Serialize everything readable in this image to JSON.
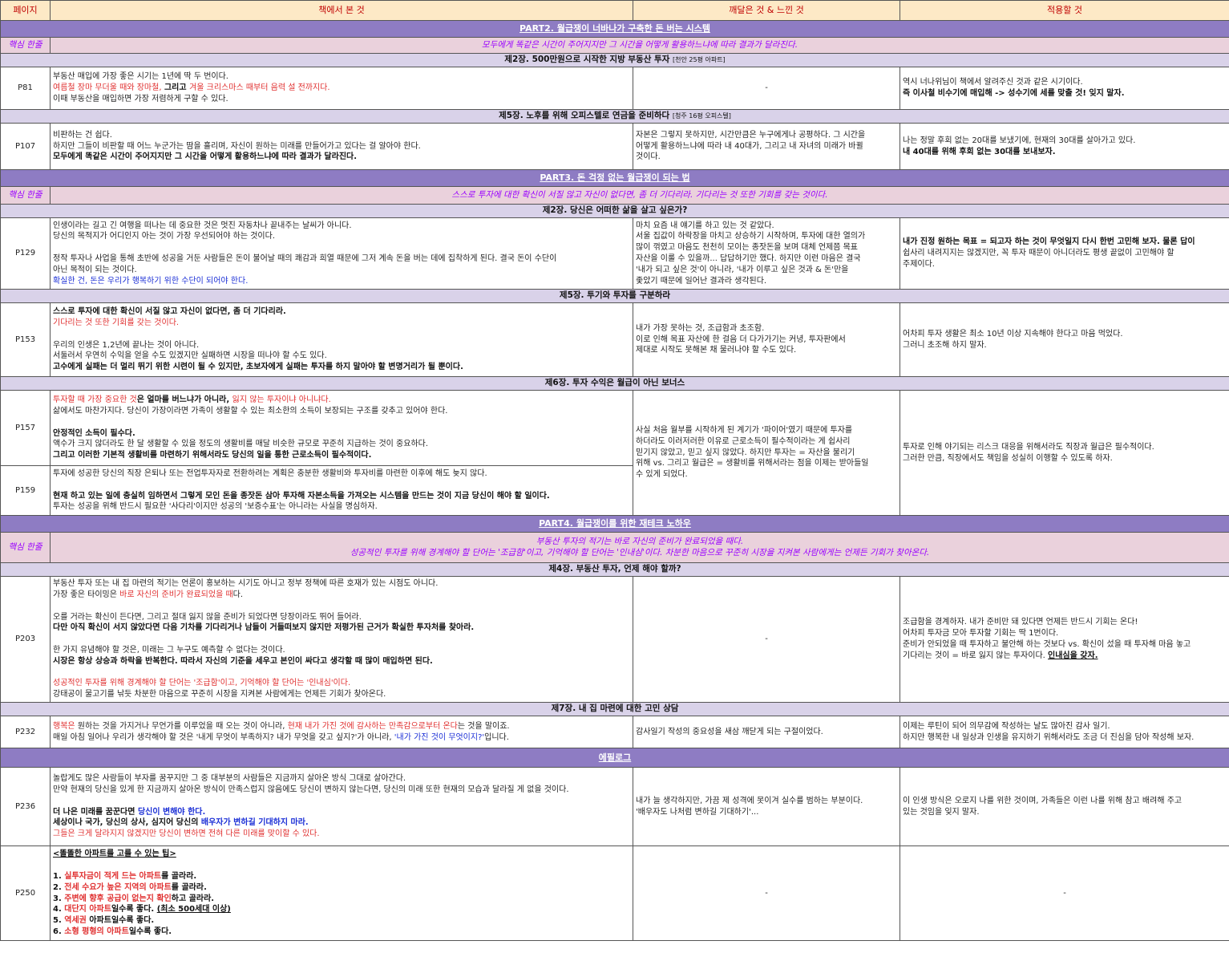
{
  "headers": {
    "page": "페이지",
    "book": "책에서 본 것",
    "realize": "깨달은 것 & 느낀 것",
    "apply": "적용할 것"
  },
  "core_label": "핵심 한줄",
  "part2": {
    "title": "PART2. 월급쟁이 너바나가 구축한 돈 버는 시스템",
    "core": "모두에게 똑같은 시간이 주어지지만 그 시간을 어떻게 활용하느냐에 따라 결과가 달라진다.",
    "ch2": {
      "title": "제2장. 500만원으로 시작한 지방 부동산 투자",
      "sub": "[천안 25평 아파트]"
    },
    "p81": {
      "page": "P81",
      "book": [
        "부동산 매입에 가장 좋은 시기는 1년에 딱 두 번이다.",
        "여름철 장마 무더울 때와 장마철,",
        " 그리고 ",
        "겨울 크리스마스 때부터 음력 설 전까지다.",
        "이때 부동산을 매입하면 가장 저렴하게 구할 수 있다."
      ],
      "realize": "-",
      "apply": [
        "역시 너나위님이 책에서 알려주신 것과 같은 시기이다.",
        "즉 이사철 비수기에 매입해 -> 성수기에 세를 맞출 것! 잊지 말자."
      ]
    },
    "ch5": {
      "title": "제5장. 노후를 위해 오피스텔로 연금을 준비하다",
      "sub": "[청주 16평 오피스텔]"
    },
    "p107": {
      "page": "P107",
      "book": [
        "비판하는 건 쉽다.",
        "하지만 그들이 비판할 때 어느 누군가는 땀을 흘리며, 자신이 원하는 미래를 만들어가고 있다는 걸 알아야 한다.",
        "모두에게 똑같은 시간이 주어지지만 그 시간을 어떻게 활용하느냐에 따라 결과가 달라진다."
      ],
      "realize": [
        "자본은 그렇지 못하지만, 시간만큼은 누구에게나 공평하다. 그 시간을",
        "어떻게 활용하느냐에 따라 내 40대가, 그리고 내 자녀의 미래가 바뀔",
        "것이다."
      ],
      "apply": [
        "나는 정말 후회 없는 20대를 보냈기에, 현재의 30대를 살아가고 있다.",
        "내 40대를 위해 후회 없는 30대를 보내보자."
      ]
    }
  },
  "part3": {
    "title": "PART3. 돈 걱정 없는 월급쟁이 되는 법",
    "core": "스스로 투자에 대한 확신이 서질 않고 자신이 없다면, 좀 더 기다리라. 기다리는 것 또한 기회를 갖는 것이다.",
    "ch2": {
      "title": "제2장. 당신은 어떠한 삶을 살고 싶은가?"
    },
    "p129": {
      "page": "P129",
      "book": [
        "인생이라는 길고 긴 여행을 떠나는 데 중요한 것은 멋진 자동차나 끝내주는 날씨가 아니다.",
        "당신의 목적지가 어디인지 아는 것이 가장 우선되어야 하는 것이다.",
        "정작 투자나 사업을 통해 초반에 성공을 거둔 사람들은 돈이 불어날 때의 쾌감과 희열 때문에 그저 계속 돈을 버는 데에 집착하게 된다. 결국 돈이 수단이",
        "아닌 목적이 되는 것이다.",
        "확실한 건, 돈은 우리가 행복하기 위한 수단이 되어야 한다."
      ],
      "realize": [
        "마치 요즘 내 얘기를 하고 있는 것 같았다.",
        "서울 집값이 하락장을 마치고 상승하기 시작하며, 투자에 대한 열의가",
        "많이 꺾였고 마음도 천천히 모이는 종잣돈을 보며 대체 언제쯤 목표",
        "자산을 이룰 수 있을까... 답답하기만 했다. 하지만 이런 마음은 결국",
        "'내가 되고 싶은 것'이 아니라, '내가 이루고 싶은 것과 & 돈'만을",
        "좇았기 때문에 일어난 결과라 생각된다."
      ],
      "apply": [
        "내가 진정 원하는 목표 = 되고자 하는 것이 무엇일지 다시 한번 고민해 보자. 물론 답이",
        "쉽사리 내려지지는 않겠지만, 꼭 투자 때문이 아니더라도 평생 끝없이 고민해야 할",
        "주제이다."
      ]
    },
    "ch5": {
      "title": "제5장. 투기와 투자를 구분하라"
    },
    "p153": {
      "page": "P153",
      "book": [
        "스스로 투자에 대한 확신이 서질 않고 자신이 없다면, 좀 더 기다리라.",
        "기다리는 것 또한 기회를 갖는 것이다.",
        "우리의 인생은 1,2년에 끝나는 것이 아니다.",
        "서둘러서 우연히 수익을 얻을 수도 있겠지만 실패하면 시장을 떠나야 할 수도 있다.",
        "고수에게 실패는 더 멀리 뛰기 위한 시련이 될 수 있지만, 초보자에게 실패는 투자를 하지 말아야 할 변명거리가 될 뿐이다."
      ],
      "realize": [
        "내가 가장 못하는 것, 조급함과 초조함.",
        "이로 인해 목표 자산에 한 걸음 더 다가가기는 커녕, 투자판에서",
        "제대로 시작도 못해본 채 물러나야 할 수도 있다."
      ],
      "apply": [
        "어차피 투자 생활은 최소 10년 이상 지속해야 한다고 마음 먹었다.",
        "그러니 초조해 하지 말자."
      ]
    },
    "ch6": {
      "title": "제6장. 투자 수익은 월급이 아닌 보너스"
    },
    "p157": {
      "page": "P157",
      "book": [
        "투자할 때 가장 중요한 것",
        "은 얼마를 버느냐가 아니라, ",
        "잃지 않는 투자이냐 아니냐다.",
        "삶에서도 마찬가지다. 당신이 가장이라면 가족이 생활할 수 있는 최소한의 소득이 보장되는 구조를 갖추고 있어야 한다.",
        "안정적인 소득이 필수다.",
        "액수가 크지 않더라도 한 달 생활할 수 있을 정도의 생활비를 매달 비슷한 규모로 꾸준히 지급하는 것이 중요하다.",
        "그리고 ",
        "이러한 기본적 생활비를 마련하기 위해서라도 당신의 일을 통한 근로소득이 필수적",
        "이다."
      ],
      "realize": [
        "사실 처음 월부를 시작하게 된 계기가 '파이어'였기 때문에 투자를",
        "하더라도 이러저러한 이유로 근로소득이 필수적이라는 게 쉽사리",
        "믿기지 않았고, 믿고 싶지 않았다. 하지만 투자는 = 자산을 불리기",
        "위해 vs. 그리고 월급은 = 생활비를 위해서라는 점을 이제는 받아들일",
        "수 있게 되었다."
      ],
      "apply": [
        "투자로 인해 야기되는 리스크 대응을 위해서라도 직장과 월급은 필수적이다.",
        "그러한 만큼, 직장에서도 책임을 성실히 이행할 수 있도록 하자."
      ]
    },
    "p159": {
      "page": "P159",
      "book": [
        "투자에 성공한 당신의 직장 은퇴나 또는 전업투자자로 전환하려는 계획은  충분한 생활비와 투자비를 마련한 이후에 해도 늦지 않다.",
        "현재 하고 있는 일에 충실히 임하면서 그렇게 모인 돈을 종잣돈 삼아 투자해 자본소득을 가져오는 시스템을 만드는 것",
        "이 지금 당신이 해야 할 일이다.",
        "투자는 성공을 위해 반드시 필요한 '사다리'이지만 성공의 '보증수표'는 아니라는 사실을 명심하자."
      ]
    }
  },
  "part4": {
    "title": "PART4. 월급쟁이를 위한 재테크 노하우",
    "core": [
      "부동산 투자의 적기는 바로 자신의 준비가 완료되었을 때다.",
      "성공적인 투자를 위해 경계해야 할 단어는 '조급함'이고, 기억해야 할 단어는 '인내심'이다. 차분한 마음으로 꾸준히 시장을 지켜본 사람에게는 언제든 기회가 찾아온다."
    ],
    "ch4": {
      "title": "제4장. 부동산 투자, 언제 해야 할까?"
    },
    "p203": {
      "page": "P203",
      "book": [
        "부동산 투자 또는 내 집 마련의 적기는 언론이 홍보하는 시기도 아니고 정부 정책에 따른 호재가 있는 시점도 아니다.",
        "가장 좋은 타이밍은 ",
        "바로 자신의 준비가 완료되었을 때",
        "다.",
        "오를 거라는 확신이 든다면, 그리고 절대 잃지 않을 준비가 되었다면 당장이라도 뛰어 들어라.",
        "다만 아직 확신이 서지 않았다면 다음 기차를 기다리거나 남들이 거들떠보지 않지만 저평가된 근거가 확실한 투자처를 찾아라.",
        "한 가지 유념해야 할 것은, 미래는 그 누구도 예측할 수 없다는 것이다.",
        "시장은 항상 상승과 하락을 반복한다. 따라서 자신의 기준을 세우고 본인이 싸다고 생각할 때 많이 매입하면 된다.",
        "성공적인 투자를 위해 경계해야 할 단어는 '조급함'이고, 기억해야 할 단어는 '인내심'이다.",
        "강태공이 물고기를 낚듯 차분한 마음으로 꾸준히 시장을 지켜본 사람에게는 언제든 기회가 찾아온다."
      ],
      "realize": "-",
      "apply": [
        "조급함을 경계하자. 내가 준비만 돼 있다면 언제든 반드시 기회는 온다!",
        "어차피 투자금 모아 투자할 기회는 딱 1번이다.",
        "준비가 안되었을 때 투자하고 불안해 하는 것보다 vs. 확신이 섰을 때 투자해 마음 놓고",
        "기다리는 것이 = 바로 잃지 않는 투자이다. ",
        "인내심을 갖자."
      ]
    },
    "ch7": {
      "title": "제7장. 내 집 마련에 대한 고민 상담"
    },
    "p232": {
      "page": "P232",
      "book": [
        "행복은",
        " 원하는 것을 가지거나 무언가를 이루었을 때 오는 것이 아니라, ",
        "현재 내가 가진 것에 감사하는 만족감으로부터 온다",
        "는 것을 말이죠.",
        "매일 아침 일어나 우리가 생각해야 할 것은 '내게 무엇이 부족하지? 내가 무엇을 갖고 싶지?'가 아니라, ",
        "'내가 가진 것이 무엇이지?'",
        "입니다."
      ],
      "realize": "감사일기 작성의 중요성을 새삼 깨닫게 되는 구절이었다.",
      "apply": [
        "이제는 루틴이 되어 의무감에 작성하는 날도 많아진 감사 일기.",
        "하지만 행복한 내 일상과 인생을 유지하기 위해서라도 조금 더 진심을 담아 작성해 보자."
      ]
    }
  },
  "epilogue": {
    "title": "에필로그",
    "p236": {
      "page": "P236",
      "book": [
        "놀랍게도 많은 사람들이 부자를 꿈꾸지만 그 중 대부분의 사람들은 지금까지 살아온 방식 그대로 살아간다.",
        "만약 현재의 당신을 있게 한 지금까지 살아온 방식이 만족스럽지 않음에도 당신이 변하지 않는다면, 당신의 미래 또한 현재의 모습과 달라질 게 없을 것이다.",
        "더 나은 미래를 꿈꾼다면 ",
        "당신이 변해야 한다.",
        "세상이나 국가, 당신의 상사, 심지어 당신의 ",
        "배우자가 변하길 기대하지 마라.",
        "그들은 크게 달라지지 않겠지만 당신이 변하면 전혀 다른 미래를 맞이할 수 있다."
      ],
      "realize": [
        "내가 늘 생각하지만, 가끔 제 성격에 못이겨 실수를 범하는 부분이다.",
        "'배우자도 나처럼 변하길 기대하기'..."
      ],
      "apply": [
        "이 인생 방식은 오로지 나를 위한 것이며, 가족들은 이런 나를 위해 참고 배려해 주고",
        "있는 것임을 잊지 말자."
      ]
    },
    "p250": {
      "page": "P250",
      "tips_title": "<똘똘한 아파트를 고를 수 있는 팁>",
      "tips": [
        {
          "n": "1. ",
          "hl": "실투자금이 적게 드는 아파트",
          "rest": "를 골라라."
        },
        {
          "n": "2. ",
          "hl": "전세 수요가 높은 지역의 아파트",
          "rest": "를 골라라."
        },
        {
          "n": "3. ",
          "hl": "주변에 향후 공급이 없는지 확인",
          "rest": "하고 골라라."
        },
        {
          "n": "4. ",
          "hl": "대단지 아파트",
          "rest": "일수록 좋다. ",
          "u": "(최소 500세대 이상)"
        },
        {
          "n": "5. ",
          "hl": "역세권",
          "rest": " 아파트일수록 좋다."
        },
        {
          "n": "6. ",
          "hl": "소형 평형의 아파트",
          "rest": "일수록 좋다."
        }
      ],
      "realize": "-",
      "apply": "-"
    }
  }
}
